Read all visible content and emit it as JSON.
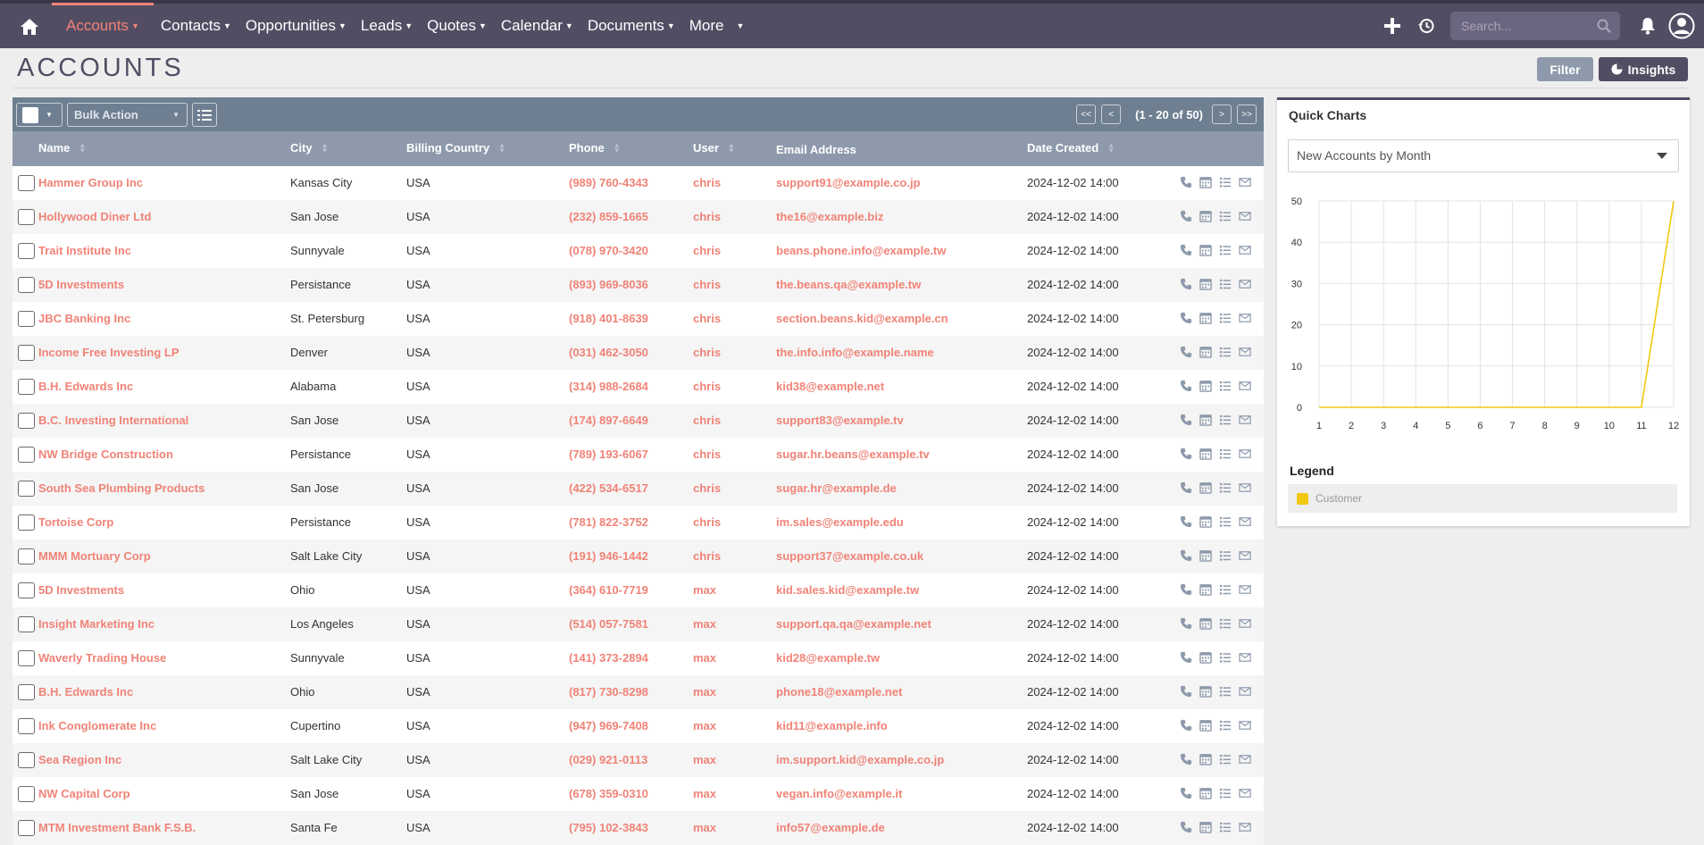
{
  "nav": {
    "items": [
      {
        "label": "Accounts",
        "active": true
      },
      {
        "label": "Contacts"
      },
      {
        "label": "Opportunities"
      },
      {
        "label": "Leads"
      },
      {
        "label": "Quotes"
      },
      {
        "label": "Calendar"
      },
      {
        "label": "Documents"
      },
      {
        "label": "More"
      }
    ],
    "search_placeholder": "Search..."
  },
  "page": {
    "title": "ACCOUNTS",
    "filter_label": "Filter",
    "insights_label": "Insights"
  },
  "toolbar": {
    "bulk_action": "Bulk Action",
    "pagination": "(1 - 20 of 50)",
    "first": "<<",
    "prev": "<",
    "next": ">",
    "last": ">>"
  },
  "table": {
    "columns": [
      "Name",
      "City",
      "Billing Country",
      "Phone",
      "User",
      "Email Address",
      "Date Created"
    ],
    "rows": [
      [
        "Hammer Group Inc",
        "Kansas City",
        "USA",
        "(989) 760-4343",
        "chris",
        "support91@example.co.jp",
        "2024-12-02 14:00"
      ],
      [
        "Hollywood Diner Ltd",
        "San Jose",
        "USA",
        "(232) 859-1665",
        "chris",
        "the16@example.biz",
        "2024-12-02 14:00"
      ],
      [
        "Trait Institute Inc",
        "Sunnyvale",
        "USA",
        "(078) 970-3420",
        "chris",
        "beans.phone.info@example.tw",
        "2024-12-02 14:00"
      ],
      [
        "5D Investments",
        "Persistance",
        "USA",
        "(893) 969-8036",
        "chris",
        "the.beans.qa@example.tw",
        "2024-12-02 14:00"
      ],
      [
        "JBC Banking Inc",
        "St. Petersburg",
        "USA",
        "(918) 401-8639",
        "chris",
        "section.beans.kid@example.cn",
        "2024-12-02 14:00"
      ],
      [
        "Income Free Investing LP",
        "Denver",
        "USA",
        "(031) 462-3050",
        "chris",
        "the.info.info@example.name",
        "2024-12-02 14:00"
      ],
      [
        "B.H. Edwards Inc",
        "Alabama",
        "USA",
        "(314) 988-2684",
        "chris",
        "kid38@example.net",
        "2024-12-02 14:00"
      ],
      [
        "B.C. Investing International",
        "San Jose",
        "USA",
        "(174) 897-6649",
        "chris",
        "support83@example.tv",
        "2024-12-02 14:00"
      ],
      [
        "NW Bridge Construction",
        "Persistance",
        "USA",
        "(789) 193-6067",
        "chris",
        "sugar.hr.beans@example.tv",
        "2024-12-02 14:00"
      ],
      [
        "South Sea Plumbing Products",
        "San Jose",
        "USA",
        "(422) 534-6517",
        "chris",
        "sugar.hr@example.de",
        "2024-12-02 14:00"
      ],
      [
        "Tortoise Corp",
        "Persistance",
        "USA",
        "(781) 822-3752",
        "chris",
        "im.sales@example.edu",
        "2024-12-02 14:00"
      ],
      [
        "MMM Mortuary Corp",
        "Salt Lake City",
        "USA",
        "(191) 946-1442",
        "chris",
        "support37@example.co.uk",
        "2024-12-02 14:00"
      ],
      [
        "5D Investments",
        "Ohio",
        "USA",
        "(364) 610-7719",
        "max",
        "kid.sales.kid@example.tw",
        "2024-12-02 14:00"
      ],
      [
        "Insight Marketing Inc",
        "Los Angeles",
        "USA",
        "(514) 057-7581",
        "max",
        "support.qa.qa@example.net",
        "2024-12-02 14:00"
      ],
      [
        "Waverly Trading House",
        "Sunnyvale",
        "USA",
        "(141) 373-2894",
        "max",
        "kid28@example.tw",
        "2024-12-02 14:00"
      ],
      [
        "B.H. Edwards Inc",
        "Ohio",
        "USA",
        "(817) 730-8298",
        "max",
        "phone18@example.net",
        "2024-12-02 14:00"
      ],
      [
        "Ink Conglomerate Inc",
        "Cupertino",
        "USA",
        "(947) 969-7408",
        "max",
        "kid11@example.info",
        "2024-12-02 14:00"
      ],
      [
        "Sea Region Inc",
        "Salt Lake City",
        "USA",
        "(029) 921-0113",
        "max",
        "im.support.kid@example.co.jp",
        "2024-12-02 14:00"
      ],
      [
        "NW Capital Corp",
        "San Jose",
        "USA",
        "(678) 359-0310",
        "max",
        "vegan.info@example.it",
        "2024-12-02 14:00"
      ],
      [
        "MTM Investment Bank F.S.B.",
        "Santa Fe",
        "USA",
        "(795) 102-3843",
        "max",
        "info57@example.de",
        "2024-12-02 14:00"
      ]
    ]
  },
  "quick_charts": {
    "title": "Quick Charts",
    "selected": "New Accounts by Month",
    "legend_title": "Legend"
  },
  "chart_data": {
    "type": "line",
    "x": [
      1,
      2,
      3,
      4,
      5,
      6,
      7,
      8,
      9,
      10,
      11,
      12
    ],
    "series": [
      {
        "name": "Customer",
        "color": "#f2c811",
        "values": [
          0,
          0,
          0,
          0,
          0,
          0,
          0,
          0,
          0,
          0,
          0,
          50
        ]
      }
    ],
    "ylim": [
      0,
      50
    ],
    "yticks": [
      0,
      10,
      20,
      30,
      40,
      50
    ],
    "grid": true,
    "legend": "bottom"
  },
  "colors": {
    "nav_bg": "#534d64",
    "accent": "#f08377",
    "toolbar": "#6e7f91",
    "header": "#8e9aac",
    "row_action_icon": "#8e9aac"
  },
  "icons": {
    "home": "home-icon",
    "create": "plus-icon",
    "recent": "history-icon",
    "search": "search-icon",
    "alerts": "bell-icon",
    "profile": "user-circle-icon",
    "columns": "list-icon",
    "row_actions": [
      "phone-icon",
      "calendar-icon",
      "tasks-icon",
      "email-icon"
    ]
  }
}
